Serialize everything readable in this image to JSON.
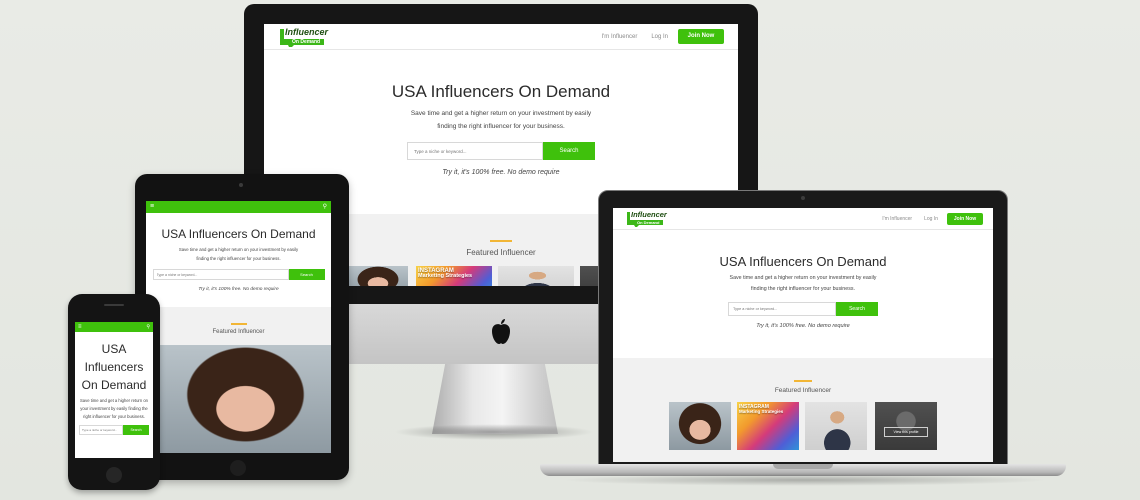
{
  "site": {
    "logo_top": "Influencer",
    "logo_bottom": "On Demand",
    "nav_influencer": "I'm Influencer",
    "nav_login": "Log In",
    "nav_join": "Join Now",
    "hero_title": "USA Influencers On Demand",
    "hero_line1": "Save time and get a higher return on your investment by easily",
    "hero_line2": "finding the right influencer for your business.",
    "hero_body": "Save time and get a higher return on your investment by easily finding the right influencer for your business.",
    "search_placeholder": "Type a niche or keyword...",
    "search_button": "Search",
    "tagline": "Try it, it's 100% free. No demo require",
    "featured_title": "Featured Influencer",
    "insta_line1": "INSTAGRAM",
    "insta_line2": "Marketing Strategies",
    "view_profile": "View this profile"
  },
  "icons": {
    "menu": "hamburger-menu-icon",
    "search": "search-icon",
    "apple": "apple-logo-icon"
  },
  "colors": {
    "brand_green": "#3fc10c",
    "accent_orange": "#f2b636",
    "background": "#e9ebe6"
  }
}
